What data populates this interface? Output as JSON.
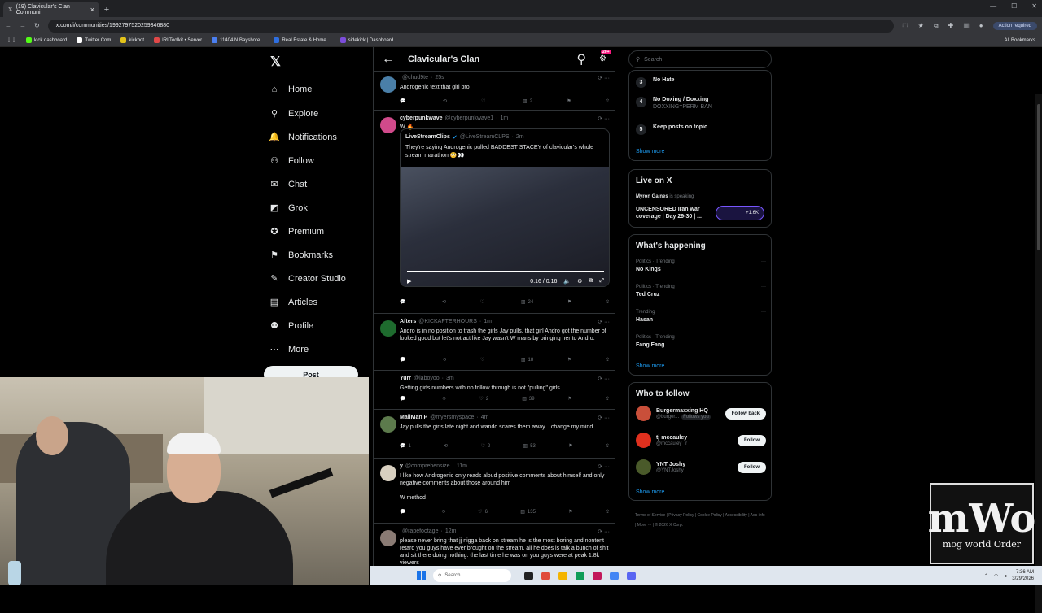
{
  "browser": {
    "tab_title": "(19) Clavicular's Clan Communi",
    "url": "x.com/i/communities/1992797520259346880",
    "action_label": "Action required",
    "bookmarks": [
      {
        "label": "kick dashboard",
        "color": "#53fc18"
      },
      {
        "label": "Twitter Com",
        "color": "#ffffff"
      },
      {
        "label": "kickbot",
        "color": "#e2c21a"
      },
      {
        "label": "IRLToolkit • Server",
        "color": "#e04848"
      },
      {
        "label": "11404 N Bayshore...",
        "color": "#4b7ff0"
      },
      {
        "label": "Real Estate & Home...",
        "color": "#2f6fe0"
      },
      {
        "label": "sidekick | Dashboard",
        "color": "#7c4ddb"
      }
    ],
    "all_bookmarks": "All Bookmarks"
  },
  "nav": {
    "items": [
      {
        "label": "Home",
        "icon": "⌂"
      },
      {
        "label": "Explore",
        "icon": "⚲"
      },
      {
        "label": "Notifications",
        "icon": "🔔"
      },
      {
        "label": "Follow",
        "icon": "⚇"
      },
      {
        "label": "Chat",
        "icon": "✉"
      },
      {
        "label": "Grok",
        "icon": "◩"
      },
      {
        "label": "Premium",
        "icon": "✪"
      },
      {
        "label": "Bookmarks",
        "icon": "⚑"
      },
      {
        "label": "Creator Studio",
        "icon": "✎"
      },
      {
        "label": "Articles",
        "icon": "▤"
      },
      {
        "label": "Profile",
        "icon": "⚉"
      },
      {
        "label": "More",
        "icon": "⋯"
      }
    ],
    "post_label": "Post"
  },
  "feed": {
    "title": "Clavicular's Clan",
    "badge": "20+",
    "tweets": [
      {
        "name": "",
        "handle": "@chud9te",
        "time": "25s",
        "text": "Androgenic text that girl bro",
        "views": "2",
        "replies": "",
        "likes": "",
        "avatar": "#4a7fa8"
      },
      {
        "name": "cyberpunkwave",
        "handle": "@cyberpunkwave1",
        "time": "1m",
        "text": "W 🔥",
        "views": "24",
        "replies": "",
        "likes": "",
        "avatar": "#d14a8b"
      },
      {
        "name": "Afters",
        "handle": "@KICKAFTERHOURS",
        "time": "1m",
        "text": "Andro is in no position to trash the girls Jay pulls, that girl Andro got the number of looked good but let's not act like Jay wasn't W mans by bringing her to Andro.",
        "views": "18",
        "replies": "",
        "likes": "",
        "avatar": "#1e6b2e"
      },
      {
        "name": "Yurr",
        "handle": "@laboyoo",
        "time": "3m",
        "text": "Getting girls numbers with no follow through is not \"pulling\" girls",
        "views": "39",
        "replies": "",
        "likes": "2",
        "avatar": "#000000"
      },
      {
        "name": "MailMan P",
        "handle": "@myersmyspace",
        "time": "4m",
        "text": "Jay pulls the girls late night and wando scares them away... change my mind.",
        "views": "53",
        "replies": "1",
        "likes": "2",
        "avatar": "#5c7a4c"
      },
      {
        "name": "y",
        "handle": "@comprehensize",
        "time": "11m",
        "text": "I like how Androgenic only reads aloud positive comments about himself and only negative comments about those around him\n\nW method",
        "views": "135",
        "replies": "",
        "likes": "6",
        "avatar": "#d8d0c0"
      },
      {
        "name": "",
        "handle": "@rapefootage",
        "time": "12m",
        "text": "please never bring that jj nigga back on stream he is the most boring and nontent retard you guys have ever brought on the stream. all he does is talk a bunch of shit and sit there doing nothing. the last time he was on you guys were at peak 1.8k viewers",
        "views": "",
        "replies": "",
        "likes": "",
        "avatar": "#8a7b74"
      }
    ],
    "quote": {
      "name": "LiveStreamClips",
      "handle": "@LiveStreamCLPS",
      "time": "2m",
      "text": "They're saying Androgenic pulled BADDEST STACEY of clavicular's whole stream marathon 😳👀",
      "video_time": "0:16 / 0:16"
    }
  },
  "sidebar": {
    "search_placeholder": "Search",
    "rules": [
      {
        "n": "3",
        "title": "No Hate",
        "sub": ""
      },
      {
        "n": "4",
        "title": "No Doxing / Doxxing",
        "sub": "DOXXING=PERM BAN"
      },
      {
        "n": "5",
        "title": "Keep posts on topic",
        "sub": ""
      }
    ],
    "show_more": "Show more",
    "live": {
      "heading": "Live on X",
      "host": "Myron Gaines",
      "host_suffix": "is speaking",
      "title": "UNCENSORED Iran war coverage | Day 29-30 | ...",
      "listeners": "+1.6K"
    },
    "happening": {
      "heading": "What's happening",
      "trends": [
        {
          "cat": "Politics · Trending",
          "name": "No Kings"
        },
        {
          "cat": "Politics · Trending",
          "name": "Ted Cruz"
        },
        {
          "cat": "Trending",
          "name": "Hasan"
        },
        {
          "cat": "Politics · Trending",
          "name": "Fang Fang"
        }
      ]
    },
    "who": {
      "heading": "Who to follow",
      "people": [
        {
          "name": "Burgermaxxing HQ",
          "handle": "@burger...",
          "extra": "Follows you",
          "button": "Follow back",
          "avatar": "#c94f3a"
        },
        {
          "name": "tj mccauley",
          "handle": "@mccauley_jr_",
          "extra": "",
          "button": "Follow",
          "avatar": "#e0301e"
        },
        {
          "name": "YNT Joshy",
          "handle": "@YNTJoshy",
          "extra": "",
          "button": "Follow",
          "avatar": "#4a5a2a"
        }
      ]
    },
    "footer": "Terms of Service | Privacy Policy | Cookie Policy | Accessibility | Ads info | More ··· | © 2026 X Corp."
  },
  "overlay": {
    "logo_main": "mWo",
    "logo_sub": "mog world Order"
  },
  "taskbar": {
    "search": "Search",
    "time": "7:36 AM",
    "date": "3/29/2026"
  }
}
